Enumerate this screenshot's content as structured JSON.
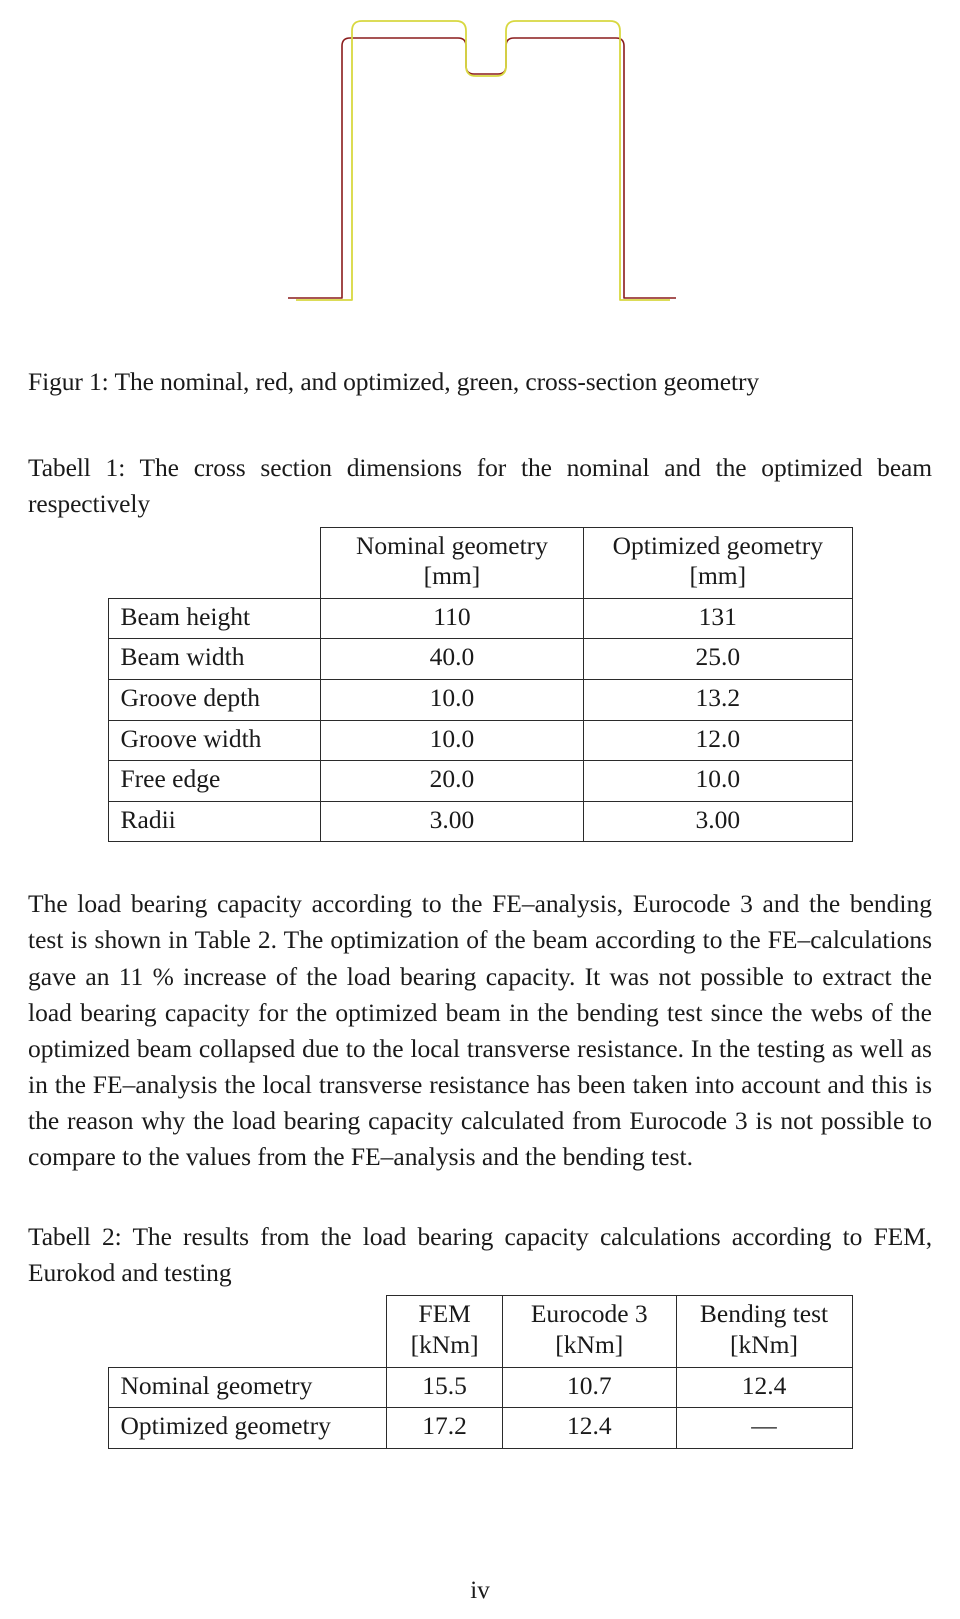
{
  "figure": {
    "caption": "Figur 1: The nominal, red, and optimized, green, cross-section geometry",
    "nominal_color": "#8a1b1b",
    "optimized_color": "#d8d840",
    "nominal_legend": "red",
    "optimized_legend": "green"
  },
  "table_one": {
    "caption": "Tabell 1: The cross section dimensions for the nominal and the optimized beam respectively",
    "headers": {
      "corner": "",
      "nominal": "Nominal geometry",
      "nominal_unit": "[mm]",
      "optimized": "Optimized geometry",
      "optimized_unit": "[mm]"
    },
    "rows": [
      {
        "label": "Beam height",
        "nominal": "110",
        "optimized": "131"
      },
      {
        "label": "Beam width",
        "nominal": "40.0",
        "optimized": "25.0"
      },
      {
        "label": "Groove depth",
        "nominal": "10.0",
        "optimized": "13.2"
      },
      {
        "label": "Groove width",
        "nominal": "10.0",
        "optimized": "12.0"
      },
      {
        "label": "Free edge",
        "nominal": "20.0",
        "optimized": "10.0"
      },
      {
        "label": "Radii",
        "nominal": "3.00",
        "optimized": "3.00"
      }
    ]
  },
  "body": {
    "paragraph_one": "The load bearing capacity according to the FE–analysis, Eurocode 3 and the bending test is shown in Table 2. The optimization of the beam according to the FE–calculations gave an 11 % increase of the load bearing capacity. It was not possible to extract the load bearing capacity for the optimized beam in the bending test since the webs of the optimized beam collapsed due to the local transverse resistance. In the testing as well as in the FE–analysis the local transverse resistance has been taken into account and this is the reason why the load bearing capacity calculated from Eurocode 3 is not possible to compare to the values from the FE–analysis and the bending test."
  },
  "table_two": {
    "caption": "Tabell 2: The results from the load bearing capacity calculations according to FEM, Eurokod and testing",
    "headers": {
      "corner": "",
      "fem": "FEM",
      "fem_unit": "[kNm]",
      "eurocode": "Eurocode 3",
      "eurocode_unit": "[kNm]",
      "bending": "Bending test",
      "bending_unit": "[kNm]"
    },
    "rows": [
      {
        "label": "Nominal geometry",
        "fem": "15.5",
        "eurocode": "10.7",
        "bending": "12.4"
      },
      {
        "label": "Optimized geometry",
        "fem": "17.2",
        "eurocode": "12.4",
        "bending": "—"
      }
    ]
  },
  "footer": {
    "page_number": "iv"
  }
}
